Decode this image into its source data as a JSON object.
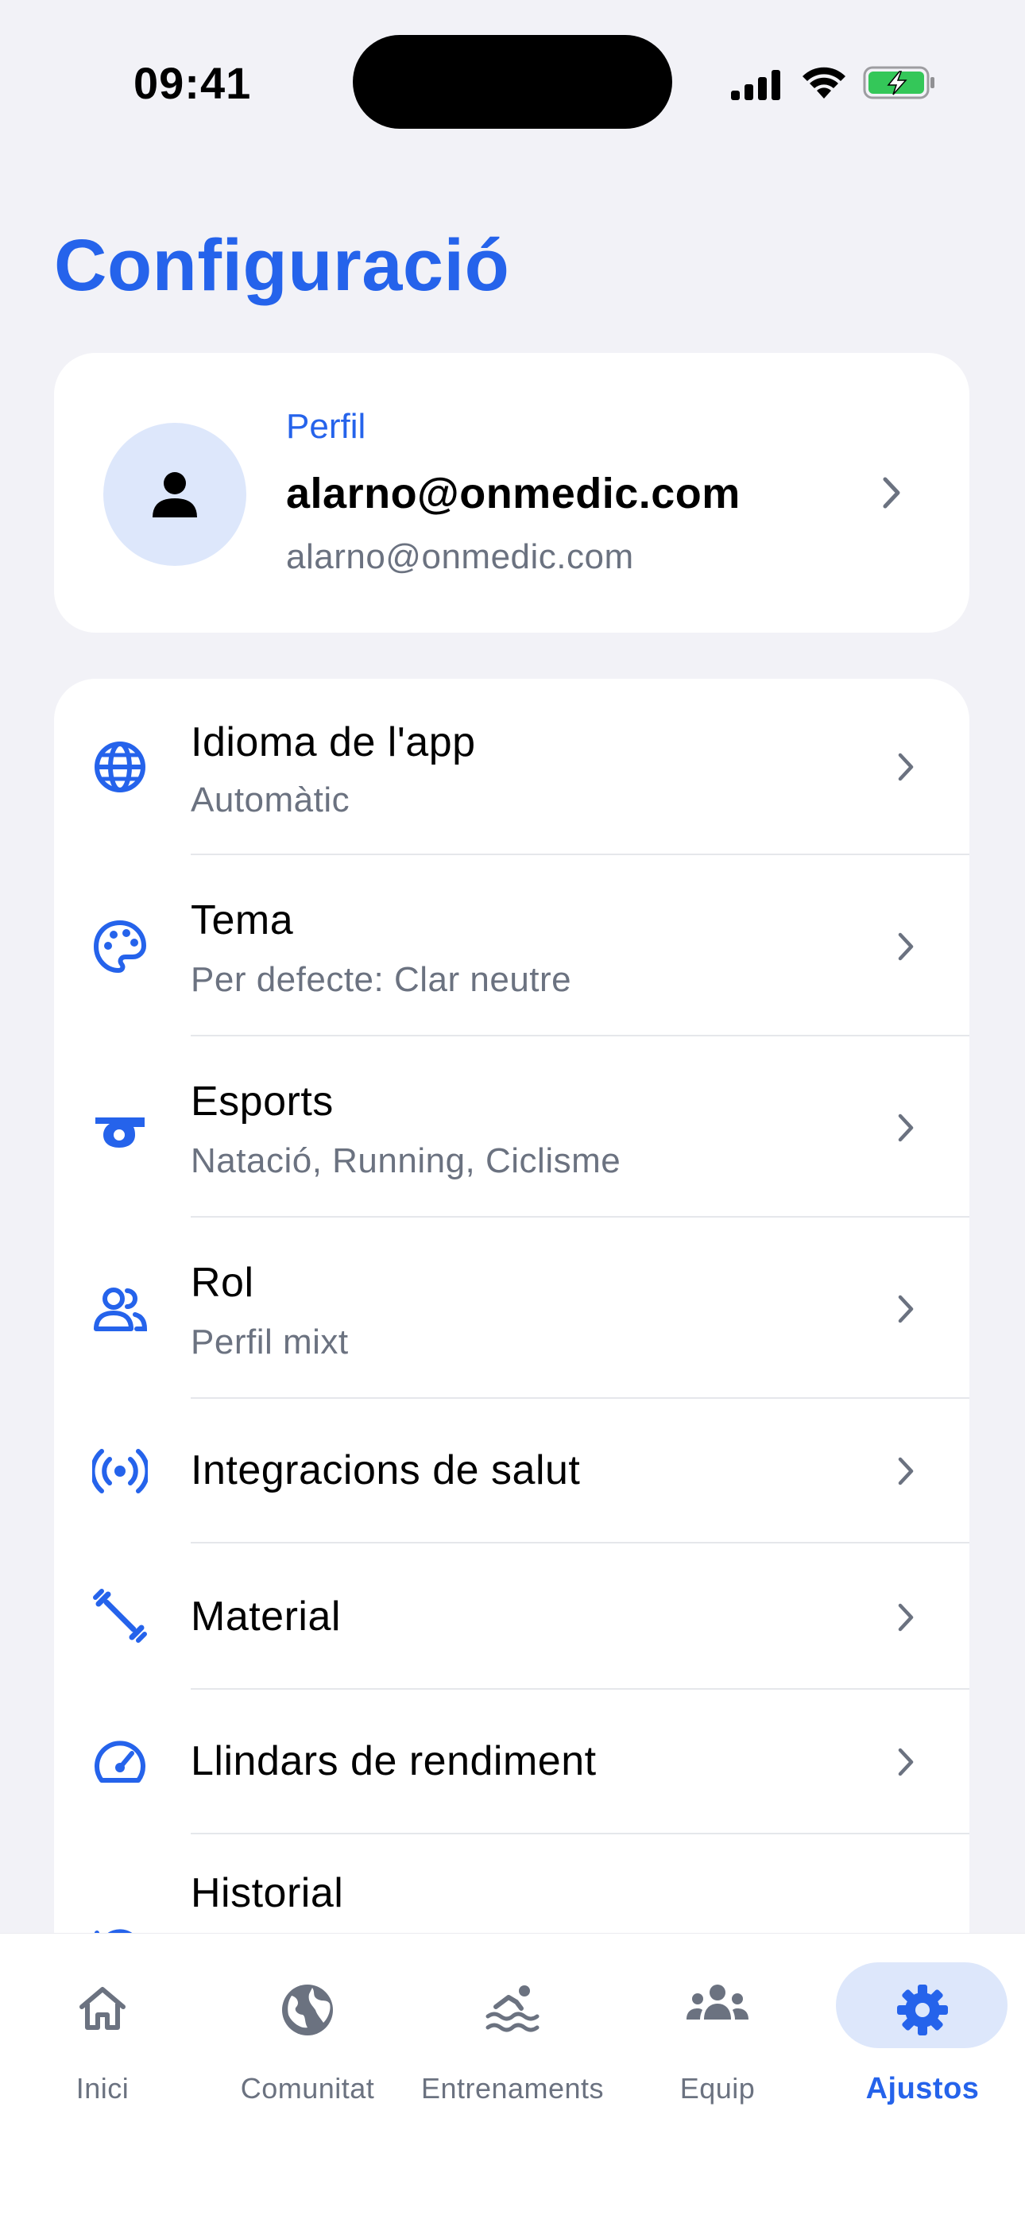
{
  "status_bar": {
    "time": "09:41"
  },
  "title": "Configuració",
  "profile": {
    "label": "Perfil",
    "name": "alarno@onmedic.com",
    "email": "alarno@onmedic.com"
  },
  "settings": [
    {
      "title": "Idioma de l'app",
      "subtitle": "Automàtic",
      "icon": "globe-icon"
    },
    {
      "title": "Tema",
      "subtitle": "Per defecte: Clar neutre",
      "icon": "palette-icon"
    },
    {
      "title": "Esports",
      "subtitle": "Natació, Running, Ciclisme",
      "icon": "whistle-icon"
    },
    {
      "title": "Rol",
      "subtitle": "Perfil mixt",
      "icon": "people-icon"
    },
    {
      "title": "Integracions de salut",
      "icon": "broadcast-icon"
    },
    {
      "title": "Material",
      "icon": "dumbbell-icon"
    },
    {
      "title": "Llindars de rendiment",
      "icon": "speedometer-icon"
    },
    {
      "title": "Historial",
      "icon": "history-icon"
    }
  ],
  "nav": [
    {
      "label": "Inici",
      "icon": "home-icon"
    },
    {
      "label": "Comunitat",
      "icon": "globe-icon"
    },
    {
      "label": "Entrenaments",
      "icon": "swim-icon"
    },
    {
      "label": "Equip",
      "icon": "group-icon"
    },
    {
      "label": "Ajustos",
      "icon": "gear-icon",
      "active": true
    }
  ],
  "colors": {
    "accent": "#2563eb",
    "accent_soft": "#dde7fb",
    "background": "#f2f2f7",
    "battery": "#34c759"
  }
}
